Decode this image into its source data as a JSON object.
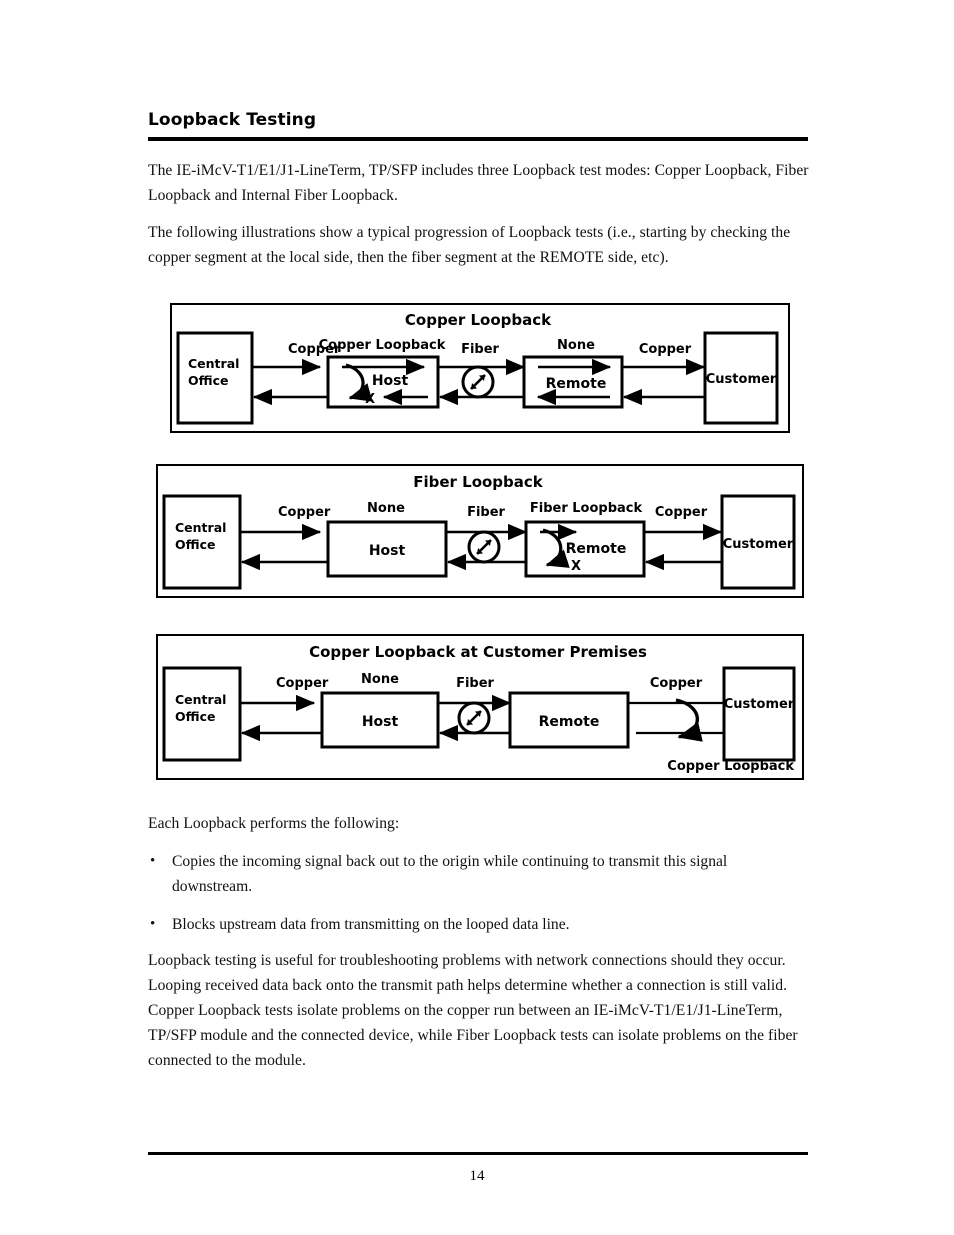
{
  "document": {
    "heading": "Loopback Testing",
    "page_number": "14",
    "paragraphs": {
      "intro": "The IE-iMcV-T1/E1/J1-LineTerm, TP/SFP includes three Loopback test modes: Copper Loopback, Fiber Loopback and Internal Fiber Loopback.",
      "illustrations": "The following illustrations show a typical progression of Loopback tests (i.e., starting by checking the copper segment at the local side, then the fiber segment at the REMOTE side, etc).",
      "each_loopback": "Each Loopback performs the following:",
      "closing": "Loopback testing is useful for troubleshooting problems with network connections should they occur.  Looping received data back onto the transmit path helps determine whether a connection is still valid.  Copper Loopback tests isolate problems on the copper run between an IE-iMcV-T1/E1/J1-LineTerm, TP/SFP module and the connected device, while Fiber Loopback tests can isolate problems on the fiber connected to the module."
    },
    "bullets": [
      {
        "marker": "•",
        "text": "Copies the incoming signal back out to the origin while continuing to transmit this signal downstream."
      },
      {
        "marker": "•",
        "text": "Blocks upstream data from transmitting on the looped data line."
      }
    ]
  },
  "diagrams": [
    {
      "id": "copper-loopback",
      "title": "Copper Loopback",
      "nodes": {
        "central_office_line1": "Central",
        "central_office_line2": "Office",
        "host": "Host",
        "remote": "Remote",
        "customer": "Customer"
      },
      "link_labels": {
        "left_copper": "Copper",
        "fiber": "Fiber",
        "right_copper": "Copper"
      },
      "mode_labels": {
        "host_mode": "Copper Loopback",
        "remote_mode": "None"
      },
      "block_marker": "X",
      "loopback_location": "host",
      "loopback_inside_box": true
    },
    {
      "id": "fiber-loopback",
      "title": "Fiber Loopback",
      "nodes": {
        "central_office_line1": "Central",
        "central_office_line2": "Office",
        "host": "Host",
        "remote": "Remote",
        "customer": "Customer"
      },
      "link_labels": {
        "left_copper": "Copper",
        "fiber": "Fiber",
        "right_copper": "Copper"
      },
      "mode_labels": {
        "host_mode": "None",
        "remote_mode": "Fiber Loopback"
      },
      "block_marker": "X",
      "loopback_location": "remote",
      "loopback_inside_box": true
    },
    {
      "id": "copper-loopback-customer-premises",
      "title": "Copper Loopback at Customer Premises",
      "nodes": {
        "central_office_line1": "Central",
        "central_office_line2": "Office",
        "host": "Host",
        "remote": "Remote",
        "customer": "Customer"
      },
      "link_labels": {
        "left_copper": "Copper",
        "fiber": "Fiber",
        "right_copper": "Copper"
      },
      "mode_labels": {
        "host_mode": "None"
      },
      "corner_label": "Copper Loopback",
      "loopback_location": "customer-premises",
      "loopback_inside_box": false
    }
  ],
  "icons": {
    "fiber_icon": "fiber-transceiver-icon"
  },
  "colors": {
    "ink": "#000000",
    "paper": "#ffffff"
  }
}
